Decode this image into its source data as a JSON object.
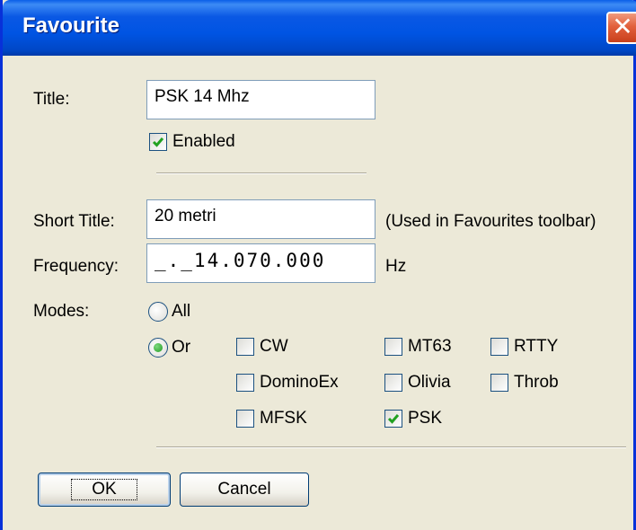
{
  "window": {
    "title": "Favourite",
    "close_glyph": "✕"
  },
  "title_field": {
    "label": "Title:",
    "value": "PSK 14 Mhz"
  },
  "enabled": {
    "label": "Enabled",
    "checked": true
  },
  "short_title": {
    "label": "Short Title:",
    "value": "20 metri",
    "hint": "(Used in Favourites toolbar)"
  },
  "frequency": {
    "label": "Frequency:",
    "value": "_._14.070.000",
    "unit": "Hz"
  },
  "modes": {
    "label": "Modes:",
    "all_label": "All",
    "or_label": "Or",
    "selected": "Or",
    "items": [
      {
        "label": "CW",
        "checked": false
      },
      {
        "label": "MT63",
        "checked": false
      },
      {
        "label": "RTTY",
        "checked": false
      },
      {
        "label": "DominoEx",
        "checked": false
      },
      {
        "label": "Olivia",
        "checked": false
      },
      {
        "label": "Throb",
        "checked": false
      },
      {
        "label": "MFSK",
        "checked": false
      },
      {
        "label": "PSK",
        "checked": true
      }
    ]
  },
  "buttons": {
    "ok": "OK",
    "cancel": "Cancel"
  },
  "colors": {
    "titlebar": "#0054e3",
    "dialog_bg": "#ece9d8",
    "close": "#e2603c",
    "check": "#21a121"
  }
}
